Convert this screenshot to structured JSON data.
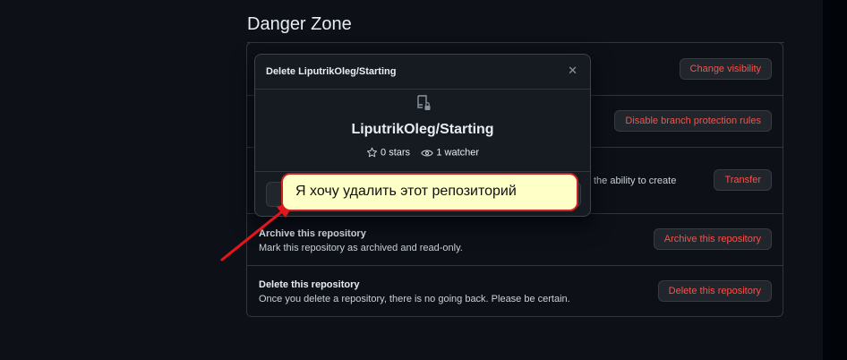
{
  "section": {
    "title": "Danger Zone"
  },
  "rows": {
    "visibility": {
      "button": "Change visibility"
    },
    "branch": {
      "button": "Disable branch protection rules"
    },
    "transfer": {
      "desc_tail": "the ability to create",
      "button": "Transfer"
    },
    "archive": {
      "title": "Archive this repository",
      "desc": "Mark this repository as archived and read-only.",
      "button": "Archive this repository"
    },
    "delete": {
      "title": "Delete this repository",
      "desc": "Once you delete a repository, there is no going back. Please be certain.",
      "button": "Delete this repository"
    }
  },
  "modal": {
    "title": "Delete LiputrikOleg/Starting",
    "repo_name": "LiputrikOleg/Starting",
    "stars": "0 stars",
    "watchers": "1 watcher",
    "close_icon": "x-icon",
    "repo_icon": "repo-locked-icon"
  },
  "annotation": {
    "text": "Я хочу удалить этот репозиторий",
    "background": "#ffffc8",
    "border": "#cc2222",
    "arrow_color": "#e8141c"
  },
  "colors": {
    "background": "#0d1117",
    "danger_text": "#f85149",
    "border": "#30363d"
  }
}
